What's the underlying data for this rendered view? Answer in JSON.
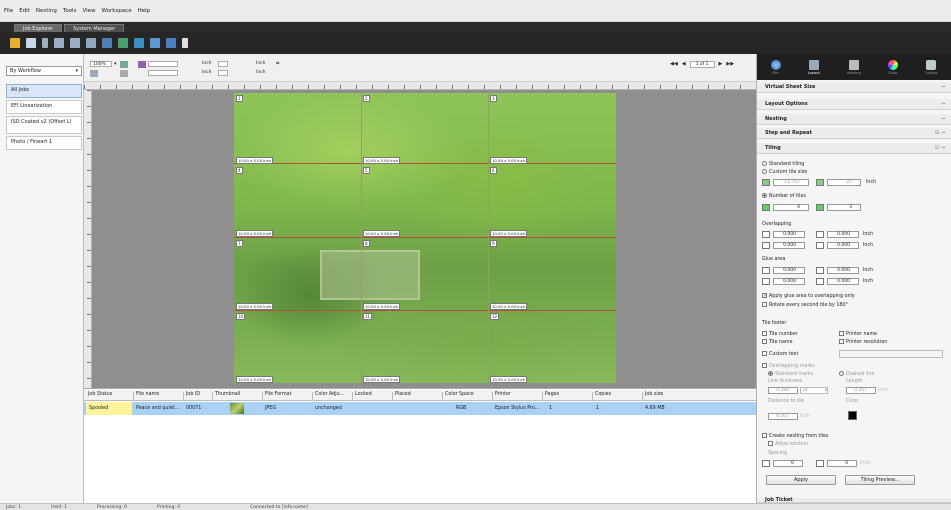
{
  "menu": [
    "File",
    "Edit",
    "Nesting",
    "Tools",
    "View",
    "Workspace",
    "Help"
  ],
  "app_tabs": [
    "Job Explorer",
    "System Manager"
  ],
  "workflow": {
    "selected": "By Workflow",
    "items": [
      "All Jobs",
      "EFI Linearization",
      "ISO Coated v2 (Offset L)",
      "Photo / Fineart 1"
    ]
  },
  "view_toolbar": {
    "zoom": "100%",
    "unit1": "Inch",
    "unit2": "Inch",
    "unit3": "Inch",
    "unit4": "Inch"
  },
  "page_nav": {
    "label": "1 of 1"
  },
  "tiles": {
    "numbers": [
      "1",
      "2",
      "3",
      "4",
      "5",
      "6",
      "7",
      "8",
      "9",
      "10",
      "11",
      "12"
    ],
    "size_label": "10.00 x 5.00 Inch"
  },
  "job_table": {
    "columns": [
      "Job Status",
      "File name",
      "Job ID",
      "Thumbnail",
      "File Format",
      "Color Adju...",
      "Locked",
      "Placed",
      "Color Space",
      "Printer",
      "Pages",
      "Copies",
      "Job size"
    ],
    "row": {
      "status": "Spooled",
      "file": "Peace and quiet...",
      "id": "00071",
      "format": "JPEG",
      "color_adj": "unchanged",
      "space": "RGB",
      "printer": "Epson Stylus Pro...",
      "pages": "1",
      "copies": "1",
      "size": "4.69 MB"
    }
  },
  "right_icons": [
    "File",
    "Layout",
    "Nesting",
    "Color",
    "Output"
  ],
  "sections": {
    "virtual": "Virtual Sheet Size",
    "layout": "Layout Options",
    "nesting": "Nesting",
    "step": "Step and Repeat",
    "tiling": "Tiling",
    "job_ticket": "Job Ticket"
  },
  "tiling": {
    "standard": "Standard tiling",
    "custom_size": "Custom tile size",
    "custom_w": "12.767",
    "custom_h": "25",
    "custom_unit": "Inch",
    "number_of_tiles": "Number of tiles",
    "num_x": "4",
    "num_y": "3",
    "overlapping": "Overlapping",
    "ov": [
      "0.000",
      "0.000",
      "0.000",
      "0.000"
    ],
    "ov_unit": "Inch",
    "glue": "Glue area",
    "glue_vals": [
      "0.000",
      "0.000",
      "0.000",
      "0.000"
    ],
    "glue_unit": "Inch",
    "apply_glue": "Apply glue area to overlapping only",
    "rotate": "Rotate every second tile by 180°",
    "footer": "Tile footer",
    "tile_number": "Tile number",
    "tile_name": "Tile name",
    "printer_name": "Printer name",
    "printer_res": "Printer resolution",
    "custom_text": "Custom text",
    "overlap_marks": "Overlapping marks",
    "standard_marks": "Standard marks",
    "dashed_line": "Dashed line",
    "line_thickness": "Line thickness",
    "line_thickness_val": "0.284",
    "line_unit": "pt",
    "length": "Length",
    "length_val": "0.207",
    "length_unit": "Inch",
    "dist": "Distance to tile",
    "dist_val": "0.207",
    "dist_unit": "Inch",
    "color": "Color",
    "nesting_from_tiles": "Create nesting from tiles",
    "allow_rotation": "Allow rotation",
    "spacing": "Spacing",
    "sp_x": "0",
    "sp_y": "0",
    "sp_unit": "Inch",
    "apply": "Apply",
    "preview": "Tiling Preview..."
  },
  "status": [
    "Jobs: 1",
    "Held: 1",
    "Processing: 0",
    "Printing: 0",
    "Connected to [info.name]"
  ]
}
